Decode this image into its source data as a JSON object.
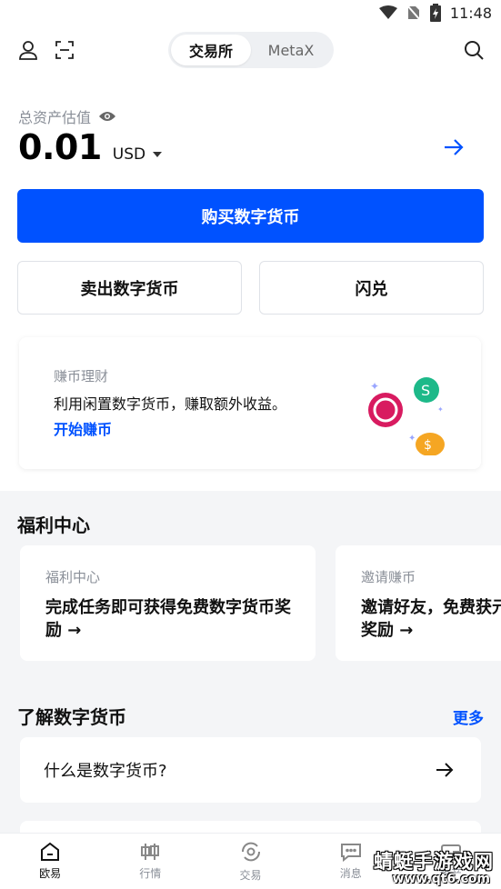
{
  "status_bar": {
    "time": "11:48"
  },
  "header": {
    "tabs": [
      {
        "label": "交易所",
        "active": true
      },
      {
        "label": "MetaX",
        "active": false
      }
    ]
  },
  "balance": {
    "label": "总资产估值",
    "value": "0.01",
    "currency": "USD"
  },
  "actions": {
    "buy": "购买数字货币",
    "sell": "卖出数字货币",
    "swap": "闪兑"
  },
  "earn": {
    "title": "赚币理财",
    "desc": "利用闲置数字货币，赚取额外收益。",
    "link": "开始赚币"
  },
  "welfare": {
    "title": "福利中心",
    "cards": [
      {
        "sub": "福利中心",
        "main": "完成任务即可获得免费数字货币奖励 →"
      },
      {
        "sub": "邀请赚币",
        "main": "邀请好友，免费获元奖励 →"
      }
    ]
  },
  "learn": {
    "title": "了解数字货币",
    "more": "更多",
    "items": [
      {
        "label": "什么是数字货币?"
      }
    ]
  },
  "tabbar": {
    "items": [
      {
        "label": "欧易",
        "icon": "home-icon",
        "active": true
      },
      {
        "label": "行情",
        "icon": "candlestick-icon",
        "active": false
      },
      {
        "label": "交易",
        "icon": "trade-icon",
        "active": false
      },
      {
        "label": "消息",
        "icon": "message-icon",
        "active": false
      },
      {
        "label": "资产",
        "icon": "wallet-icon",
        "active": false
      }
    ]
  },
  "watermark": {
    "text": "蜻蜓手游戏网",
    "url": "www.qt6.com"
  },
  "colors": {
    "accent": "#0052ff",
    "section_bg": "#f4f5f7"
  }
}
